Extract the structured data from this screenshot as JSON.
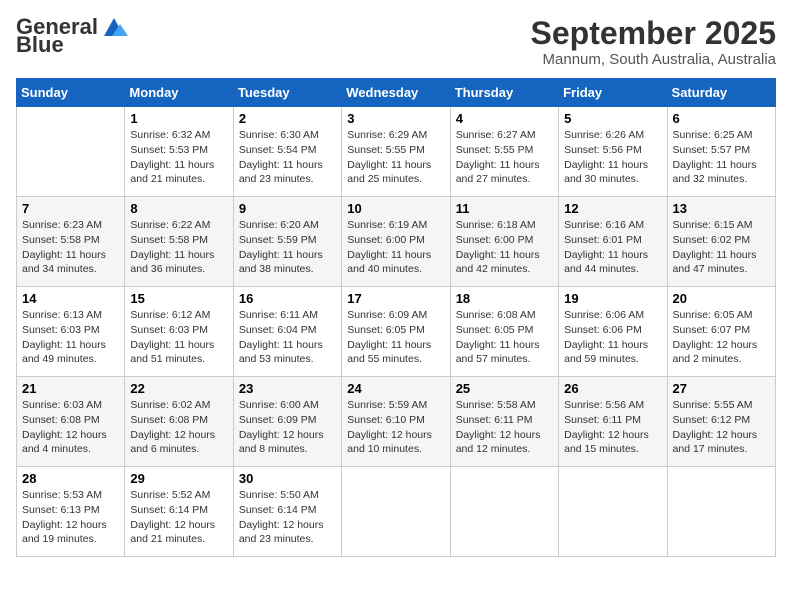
{
  "logo": {
    "general": "General",
    "blue": "Blue"
  },
  "title": "September 2025",
  "location": "Mannum, South Australia, Australia",
  "days_of_week": [
    "Sunday",
    "Monday",
    "Tuesday",
    "Wednesday",
    "Thursday",
    "Friday",
    "Saturday"
  ],
  "weeks": [
    [
      {
        "day": "",
        "info": ""
      },
      {
        "day": "1",
        "info": "Sunrise: 6:32 AM\nSunset: 5:53 PM\nDaylight: 11 hours\nand 21 minutes."
      },
      {
        "day": "2",
        "info": "Sunrise: 6:30 AM\nSunset: 5:54 PM\nDaylight: 11 hours\nand 23 minutes."
      },
      {
        "day": "3",
        "info": "Sunrise: 6:29 AM\nSunset: 5:55 PM\nDaylight: 11 hours\nand 25 minutes."
      },
      {
        "day": "4",
        "info": "Sunrise: 6:27 AM\nSunset: 5:55 PM\nDaylight: 11 hours\nand 27 minutes."
      },
      {
        "day": "5",
        "info": "Sunrise: 6:26 AM\nSunset: 5:56 PM\nDaylight: 11 hours\nand 30 minutes."
      },
      {
        "day": "6",
        "info": "Sunrise: 6:25 AM\nSunset: 5:57 PM\nDaylight: 11 hours\nand 32 minutes."
      }
    ],
    [
      {
        "day": "7",
        "info": "Sunrise: 6:23 AM\nSunset: 5:58 PM\nDaylight: 11 hours\nand 34 minutes."
      },
      {
        "day": "8",
        "info": "Sunrise: 6:22 AM\nSunset: 5:58 PM\nDaylight: 11 hours\nand 36 minutes."
      },
      {
        "day": "9",
        "info": "Sunrise: 6:20 AM\nSunset: 5:59 PM\nDaylight: 11 hours\nand 38 minutes."
      },
      {
        "day": "10",
        "info": "Sunrise: 6:19 AM\nSunset: 6:00 PM\nDaylight: 11 hours\nand 40 minutes."
      },
      {
        "day": "11",
        "info": "Sunrise: 6:18 AM\nSunset: 6:00 PM\nDaylight: 11 hours\nand 42 minutes."
      },
      {
        "day": "12",
        "info": "Sunrise: 6:16 AM\nSunset: 6:01 PM\nDaylight: 11 hours\nand 44 minutes."
      },
      {
        "day": "13",
        "info": "Sunrise: 6:15 AM\nSunset: 6:02 PM\nDaylight: 11 hours\nand 47 minutes."
      }
    ],
    [
      {
        "day": "14",
        "info": "Sunrise: 6:13 AM\nSunset: 6:03 PM\nDaylight: 11 hours\nand 49 minutes."
      },
      {
        "day": "15",
        "info": "Sunrise: 6:12 AM\nSunset: 6:03 PM\nDaylight: 11 hours\nand 51 minutes."
      },
      {
        "day": "16",
        "info": "Sunrise: 6:11 AM\nSunset: 6:04 PM\nDaylight: 11 hours\nand 53 minutes."
      },
      {
        "day": "17",
        "info": "Sunrise: 6:09 AM\nSunset: 6:05 PM\nDaylight: 11 hours\nand 55 minutes."
      },
      {
        "day": "18",
        "info": "Sunrise: 6:08 AM\nSunset: 6:05 PM\nDaylight: 11 hours\nand 57 minutes."
      },
      {
        "day": "19",
        "info": "Sunrise: 6:06 AM\nSunset: 6:06 PM\nDaylight: 11 hours\nand 59 minutes."
      },
      {
        "day": "20",
        "info": "Sunrise: 6:05 AM\nSunset: 6:07 PM\nDaylight: 12 hours\nand 2 minutes."
      }
    ],
    [
      {
        "day": "21",
        "info": "Sunrise: 6:03 AM\nSunset: 6:08 PM\nDaylight: 12 hours\nand 4 minutes."
      },
      {
        "day": "22",
        "info": "Sunrise: 6:02 AM\nSunset: 6:08 PM\nDaylight: 12 hours\nand 6 minutes."
      },
      {
        "day": "23",
        "info": "Sunrise: 6:00 AM\nSunset: 6:09 PM\nDaylight: 12 hours\nand 8 minutes."
      },
      {
        "day": "24",
        "info": "Sunrise: 5:59 AM\nSunset: 6:10 PM\nDaylight: 12 hours\nand 10 minutes."
      },
      {
        "day": "25",
        "info": "Sunrise: 5:58 AM\nSunset: 6:11 PM\nDaylight: 12 hours\nand 12 minutes."
      },
      {
        "day": "26",
        "info": "Sunrise: 5:56 AM\nSunset: 6:11 PM\nDaylight: 12 hours\nand 15 minutes."
      },
      {
        "day": "27",
        "info": "Sunrise: 5:55 AM\nSunset: 6:12 PM\nDaylight: 12 hours\nand 17 minutes."
      }
    ],
    [
      {
        "day": "28",
        "info": "Sunrise: 5:53 AM\nSunset: 6:13 PM\nDaylight: 12 hours\nand 19 minutes."
      },
      {
        "day": "29",
        "info": "Sunrise: 5:52 AM\nSunset: 6:14 PM\nDaylight: 12 hours\nand 21 minutes."
      },
      {
        "day": "30",
        "info": "Sunrise: 5:50 AM\nSunset: 6:14 PM\nDaylight: 12 hours\nand 23 minutes."
      },
      {
        "day": "",
        "info": ""
      },
      {
        "day": "",
        "info": ""
      },
      {
        "day": "",
        "info": ""
      },
      {
        "day": "",
        "info": ""
      }
    ]
  ]
}
